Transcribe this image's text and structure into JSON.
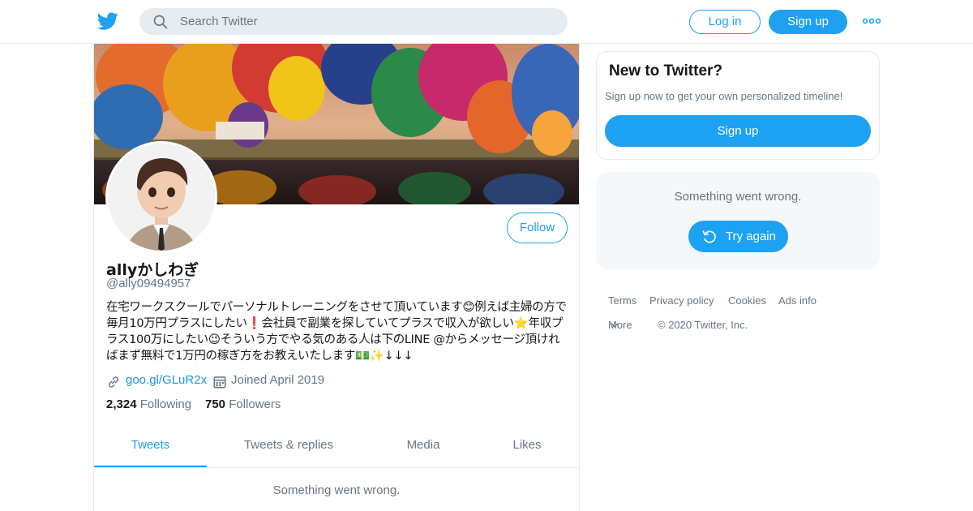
{
  "header": {
    "search_placeholder": "Search Twitter",
    "login_label": "Log in",
    "signup_label": "Sign up"
  },
  "profile": {
    "display_name": "allyかしわぎ",
    "handle": "@ally09494957",
    "follow_label": "Follow",
    "bio": "在宅ワークスクールでパーソナルトレーニングをさせて頂いています😊例えば主婦の方で毎月10万円プラスにしたい❗会社員で副業を探していてプラスで収入が欲しい⭐年収プラス100万にしたい😉そういう方でやる気のある人は下のLINE @からメッセージ頂ければまず無料で1万円の稼ぎ方をお教えいたします💵✨↓↓↓",
    "link": "goo.gl/GLuR2x",
    "joined": "Joined April 2019",
    "following_count": "2,324",
    "following_label": "Following",
    "followers_count": "750",
    "followers_label": "Followers"
  },
  "tabs": [
    {
      "label": "Tweets",
      "active": true
    },
    {
      "label": "Tweets & replies",
      "active": false
    },
    {
      "label": "Media",
      "active": false
    },
    {
      "label": "Likes",
      "active": false
    }
  ],
  "timeline": {
    "error_text": "Something went wrong."
  },
  "sidebar": {
    "new_title": "New to Twitter?",
    "new_subtitle": "Sign up now to get your own personalized timeline!",
    "signup_label": "Sign up",
    "error_text": "Something went wrong.",
    "retry_label": "Try again"
  },
  "footer": {
    "terms": "Terms",
    "privacy": "Privacy policy",
    "cookies": "Cookies",
    "ads": "Ads info",
    "more": "More",
    "copyright": "© 2020 Twitter, Inc."
  },
  "colors": {
    "accent": "#1da1f2",
    "text_secondary": "#657786",
    "border": "#e6ecf0"
  },
  "icons": [
    "twitter-bird-icon",
    "search-icon",
    "more-dots-icon",
    "link-icon",
    "calendar-icon",
    "refresh-icon",
    "chevron-down-icon"
  ]
}
